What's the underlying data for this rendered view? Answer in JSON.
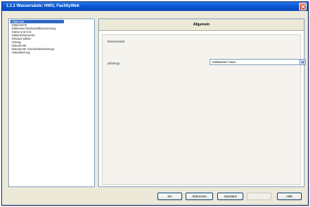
{
  "window": {
    "title": "1.1.1 Wassersäule: HWG, FacilityWeb"
  },
  "nav": {
    "items": [
      {
        "label": "Allgemein",
        "selected": true
      },
      {
        "label": "Zählerwerte",
        "selected": false
      },
      {
        "label": "Zählerwert Buchwert/Bezeichnung",
        "selected": false
      },
      {
        "label": "Status und S.N.",
        "selected": false
      },
      {
        "label": "Zählerhöhenwerte",
        "selected": false
      },
      {
        "label": "Relative Zähler",
        "selected": false
      },
      {
        "label": "Vertrag",
        "selected": false
      },
      {
        "label": "Dokumente",
        "selected": false
      },
      {
        "label": "Dokumente Gemeindewerkzeuge",
        "selected": false
      },
      {
        "label": "Aktualisierung",
        "selected": false
      }
    ]
  },
  "content": {
    "title": "Allgemein",
    "group_label": "Wassersäule",
    "field_label": "Zählertyp",
    "select_value": "Kaltwasser Haus"
  },
  "buttons": {
    "ok": "OK",
    "cancel": "Abbrechen",
    "standard": "Standard",
    "apply": "",
    "help": "Hilfe"
  },
  "colors": {
    "titlebar": "#0c59d6",
    "selection": "#316ac5",
    "window_bg": "#ece9d8"
  }
}
